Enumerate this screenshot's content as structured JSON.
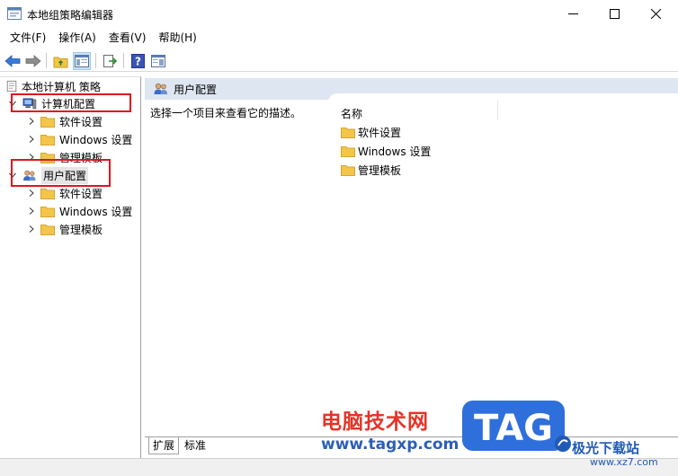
{
  "window": {
    "title": "本地组策略编辑器"
  },
  "menu": [
    "文件(F)",
    "操作(A)",
    "查看(V)",
    "帮助(H)"
  ],
  "tree": {
    "root": "本地计算机 策略",
    "computer": {
      "label": "计算机配置",
      "children": [
        "软件设置",
        "Windows 设置",
        "管理模板"
      ]
    },
    "user": {
      "label": "用户配置",
      "children": [
        "软件设置",
        "Windows 设置",
        "管理模板"
      ]
    }
  },
  "right": {
    "header": "用户配置",
    "description": "选择一个项目来查看它的描述。",
    "column_name": "名称",
    "items": [
      "软件设置",
      "Windows 设置",
      "管理模板"
    ]
  },
  "tabs": [
    "扩展",
    "标准"
  ],
  "watermark": {
    "site_cn": "电脑技术网",
    "site_url": "www.tagxp.com",
    "tag": "TAG",
    "xz_name": "极光下载站",
    "xz_url": "www.xz7.com"
  },
  "colors": {
    "highlight_box": "#e0161b",
    "header_bg": "#dde6f1",
    "folder": "#f3c64a"
  }
}
